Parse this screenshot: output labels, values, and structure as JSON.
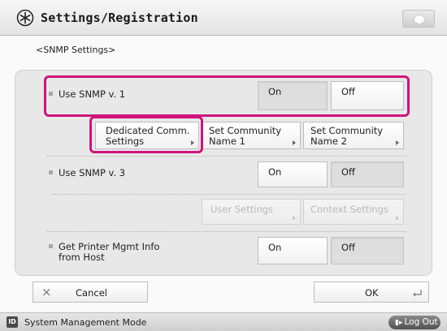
{
  "header": {
    "title": "Settings/Registration"
  },
  "page": {
    "subtitle": "<SNMP Settings>"
  },
  "snmp_v1": {
    "label": "Use SNMP v. 1",
    "on_label": "On",
    "off_label": "Off",
    "selected": "On"
  },
  "v1_options": {
    "dedicated_label_1": "Dedicated Comm.",
    "dedicated_label_2": "Settings",
    "community1_label_1": "Set Community",
    "community1_label_2": "Name 1",
    "community2_label_1": "Set Community",
    "community2_label_2": "Name 2"
  },
  "snmp_v3": {
    "label": "Use SNMP v. 3",
    "on_label": "On",
    "off_label": "Off",
    "selected": "Off"
  },
  "v3_options": {
    "user_settings_label": "User Settings",
    "context_settings_label": "Context Settings"
  },
  "printer_mgmt": {
    "label_1": "Get Printer Mgmt Info",
    "label_2": "from Host",
    "on_label": "On",
    "off_label": "Off",
    "selected": "Off"
  },
  "footer": {
    "cancel_label": "Cancel",
    "ok_label": "OK"
  },
  "status": {
    "mode_icon_text": "ID",
    "mode_label": "System Management Mode",
    "logout_label": "Log Out"
  },
  "colors": {
    "highlight": "#d0137d"
  },
  "icons": [
    "settings-icon",
    "counter-icon",
    "close-icon",
    "enter-icon",
    "id-icon",
    "logout-icon",
    "submenu-arrow-icon"
  ]
}
